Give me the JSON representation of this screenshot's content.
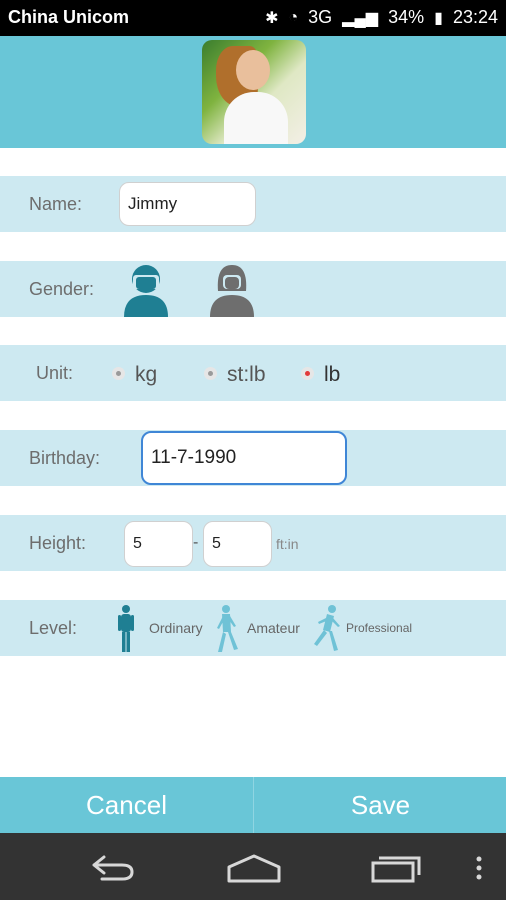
{
  "status_bar": {
    "carrier": "China Unicom",
    "network": "3G",
    "battery": "34%",
    "time": "23:24"
  },
  "form": {
    "name": {
      "label": "Name:",
      "value": "Jimmy"
    },
    "gender": {
      "label": "Gender:"
    },
    "unit": {
      "label": "Unit:",
      "options": [
        "kg",
        "st:lb",
        "lb"
      ],
      "selected": "lb"
    },
    "birthday": {
      "label": "Birthday:",
      "value": "11-7-1990"
    },
    "height": {
      "label": "Height:",
      "feet": "5",
      "separator": "-",
      "inches": "5",
      "unit": "ft:in"
    },
    "level": {
      "label": "Level:",
      "options": [
        "Ordinary",
        "Amateur",
        "Professional"
      ]
    }
  },
  "footer": {
    "cancel": "Cancel",
    "save": "Save"
  },
  "colors": {
    "accent": "#69c6d7",
    "row": "#cde9f1",
    "male": "#1f7f93",
    "female": "#6e6e6e",
    "selected_radio": "#e23a3a"
  },
  "icons": {
    "status": [
      "bluetooth-icon",
      "signal-icon",
      "wifi-icon",
      "battery-icon"
    ],
    "gender": [
      "male-icon",
      "female-icon"
    ],
    "levels": [
      "ordinary-runner-icon",
      "amateur-runner-icon",
      "professional-runner-icon"
    ],
    "nav": [
      "back-icon",
      "home-icon",
      "recents-icon",
      "menu-icon"
    ]
  }
}
